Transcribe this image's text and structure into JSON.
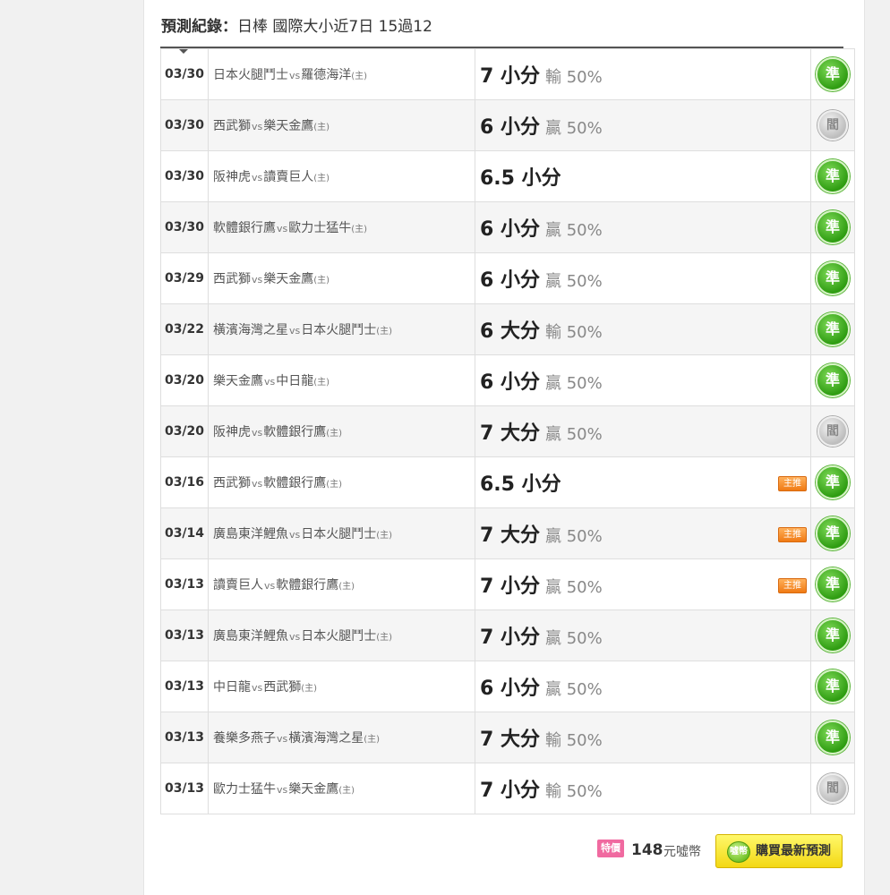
{
  "header": {
    "label": "預測紀錄",
    "separator": "：",
    "summary": "日棒 國際大小近7日 15過12"
  },
  "records": [
    {
      "date": "03/30",
      "away": "日本火腿鬥士",
      "vs": "vs",
      "home": "羅德海洋",
      "home_tag": "(主)",
      "pick": "7 小分",
      "result": "輸 50%",
      "host_badge": "",
      "status": "win",
      "status_label": "準"
    },
    {
      "date": "03/30",
      "away": "西武獅",
      "vs": "vs",
      "home": "樂天金鷹",
      "home_tag": "(主)",
      "pick": "6 小分",
      "result": "贏 50%",
      "host_badge": "",
      "status": "push",
      "status_label": "閻"
    },
    {
      "date": "03/30",
      "away": "阪神虎",
      "vs": "vs",
      "home": "讀賣巨人",
      "home_tag": "(主)",
      "pick": "6.5 小分",
      "result": "",
      "host_badge": "",
      "status": "win",
      "status_label": "準"
    },
    {
      "date": "03/30",
      "away": "軟體銀行鷹",
      "vs": "vs",
      "home": "歐力士猛牛",
      "home_tag": "(主)",
      "pick": "6 小分",
      "result": "贏 50%",
      "host_badge": "",
      "status": "win",
      "status_label": "準"
    },
    {
      "date": "03/29",
      "away": "西武獅",
      "vs": "vs",
      "home": "樂天金鷹",
      "home_tag": "(主)",
      "pick": "6 小分",
      "result": "贏 50%",
      "host_badge": "",
      "status": "win",
      "status_label": "準"
    },
    {
      "date": "03/22",
      "away": "橫濱海灣之星",
      "vs": "vs",
      "home": "日本火腿鬥士",
      "home_tag": "(主)",
      "pick": "6 大分",
      "result": "輸 50%",
      "host_badge": "",
      "status": "win",
      "status_label": "準"
    },
    {
      "date": "03/20",
      "away": "樂天金鷹",
      "vs": "vs",
      "home": "中日龍",
      "home_tag": "(主)",
      "pick": "6 小分",
      "result": "贏 50%",
      "host_badge": "",
      "status": "win",
      "status_label": "準"
    },
    {
      "date": "03/20",
      "away": "阪神虎",
      "vs": "vs",
      "home": "軟體銀行鷹",
      "home_tag": "(主)",
      "pick": "7 大分",
      "result": "贏 50%",
      "host_badge": "",
      "status": "push",
      "status_label": "閻"
    },
    {
      "date": "03/16",
      "away": "西武獅",
      "vs": "vs",
      "home": "軟體銀行鷹",
      "home_tag": "(主)",
      "pick": "6.5 小分",
      "result": "",
      "host_badge": "主推",
      "status": "win",
      "status_label": "準"
    },
    {
      "date": "03/14",
      "away": "廣島東洋鯉魚",
      "vs": "vs",
      "home": "日本火腿鬥士",
      "home_tag": "(主)",
      "pick": "7 大分",
      "result": "贏 50%",
      "host_badge": "主推",
      "status": "win",
      "status_label": "準"
    },
    {
      "date": "03/13",
      "away": "讀賣巨人",
      "vs": "vs",
      "home": "軟體銀行鷹",
      "home_tag": "(主)",
      "pick": "7 小分",
      "result": "贏 50%",
      "host_badge": "主推",
      "status": "win",
      "status_label": "準"
    },
    {
      "date": "03/13",
      "away": "廣島東洋鯉魚",
      "vs": "vs",
      "home": "日本火腿鬥士",
      "home_tag": "(主)",
      "pick": "7 小分",
      "result": "贏 50%",
      "host_badge": "",
      "status": "win",
      "status_label": "準"
    },
    {
      "date": "03/13",
      "away": "中日龍",
      "vs": "vs",
      "home": "西武獅",
      "home_tag": "(主)",
      "pick": "6 小分",
      "result": "贏 50%",
      "host_badge": "",
      "status": "win",
      "status_label": "準"
    },
    {
      "date": "03/13",
      "away": "養樂多燕子",
      "vs": "vs",
      "home": "橫濱海灣之星",
      "home_tag": "(主)",
      "pick": "7 大分",
      "result": "輸 50%",
      "host_badge": "",
      "status": "win",
      "status_label": "準"
    },
    {
      "date": "03/13",
      "away": "歐力士猛牛",
      "vs": "vs",
      "home": "樂天金鷹",
      "home_tag": "(主)",
      "pick": "7 小分",
      "result": "輸 50%",
      "host_badge": "",
      "status": "push",
      "status_label": "閻"
    }
  ],
  "footer": {
    "special_badge": "特價",
    "price": "148",
    "unit": "元噓幣",
    "buy_label": "購買最新預測",
    "coin_icon": "coin-icon",
    "coin_text": "噓幣"
  },
  "colors": {
    "win": "#2f9d12",
    "push": "#bdbdbd",
    "host_badge": "#f07a14",
    "special": "#f06aa0",
    "buy_button": "#f3d814"
  }
}
